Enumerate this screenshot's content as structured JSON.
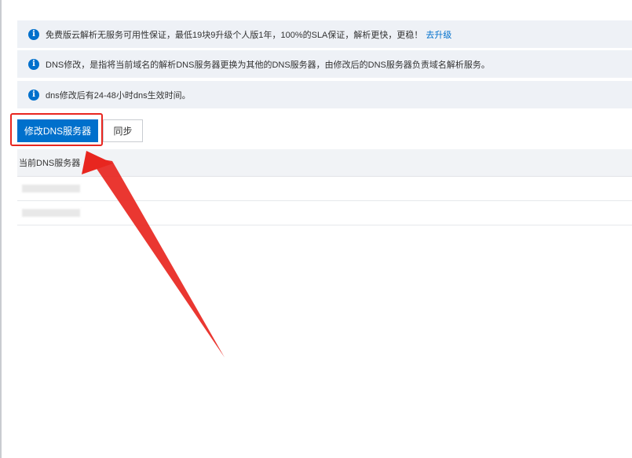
{
  "notices": [
    {
      "text": "免费版云解析无服务可用性保证，最低19块9升级个人版1年，100%的SLA保证，解析更快，更稳！",
      "link": "去升级"
    },
    {
      "text": "DNS修改，是指将当前域名的解析DNS服务器更换为其他的DNS服务器，由修改后的DNS服务器负责域名解析服务。"
    },
    {
      "text": "dns修改后有24-48小时dns生效时间。"
    }
  ],
  "buttons": {
    "modify": "修改DNS服务器",
    "sync": "同步"
  },
  "table": {
    "header": "当前DNS服务器"
  },
  "colors": {
    "accent": "#0070cc",
    "annotation": "#e8261f"
  },
  "icons": {
    "notice": "info-icon"
  }
}
